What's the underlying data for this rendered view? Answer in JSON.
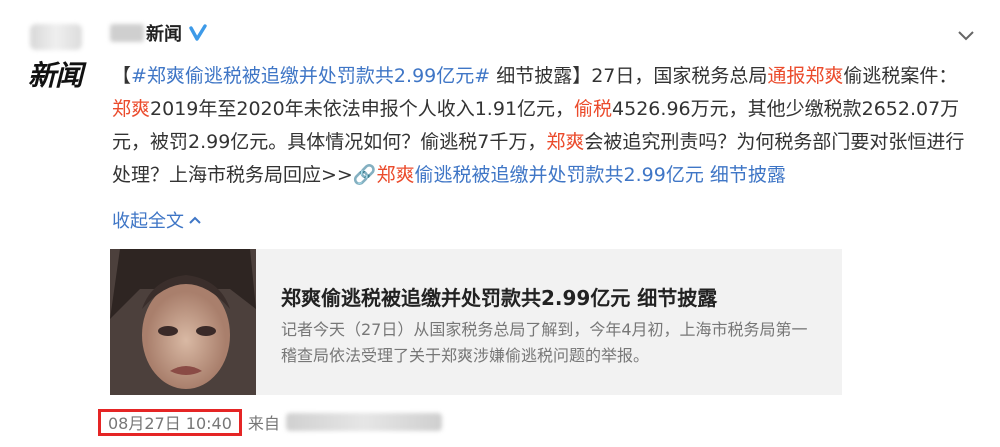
{
  "post": {
    "username": "新闻",
    "avatar_text": "新闻",
    "content_parts": [
      {
        "text": "【",
        "style": "normal"
      },
      {
        "text": "#郑爽偷逃税被追缴并处罚款共2.99亿元#",
        "style": "link"
      },
      {
        "text": " 细节披露】27日，国家税务总局",
        "style": "normal"
      },
      {
        "text": "通报郑爽",
        "style": "orange"
      },
      {
        "text": "偷逃税案件：",
        "style": "normal"
      },
      {
        "text": "郑爽",
        "style": "orange"
      },
      {
        "text": "2019年至2020年未依法申报个人收入1.91亿元，",
        "style": "normal"
      },
      {
        "text": "偷税",
        "style": "orange"
      },
      {
        "text": "4526.96万元，其他少缴税款2652.07万元，被罚2.99亿元。具体情况如何？偷逃税7千万，",
        "style": "normal"
      },
      {
        "text": "郑爽",
        "style": "orange"
      },
      {
        "text": "会被追究刑责吗？为何税务部门要对张恒进行处理？上海市税务局回应>>",
        "style": "normal"
      },
      {
        "text": "🔗",
        "style": "link"
      },
      {
        "text": "郑爽",
        "style": "orange"
      },
      {
        "text": "偷逃税被追缴并处罚款共2.99亿元 细节披露",
        "style": "link"
      }
    ],
    "collapse_label": "收起全文"
  },
  "card": {
    "title": "郑爽偷逃税被追缴并处罚款共2.99亿元 细节披露",
    "summary": "记者今天（27日）从国家税务总局了解到，今年4月初，上海市税务局第一稽查局依法受理了关于郑爽涉嫌偷逃税问题的举报。"
  },
  "meta": {
    "timestamp": "08月27日 10:40",
    "from_label": "来自"
  },
  "colors": {
    "link": "#3f76c6",
    "highlight": "#eb4b2c",
    "verified": "#3d9ae8",
    "timestamp_box": "#e52525"
  },
  "icons": [
    "verified-badge-icon",
    "chevron-down-icon",
    "link-icon",
    "collapse-up-icon"
  ]
}
